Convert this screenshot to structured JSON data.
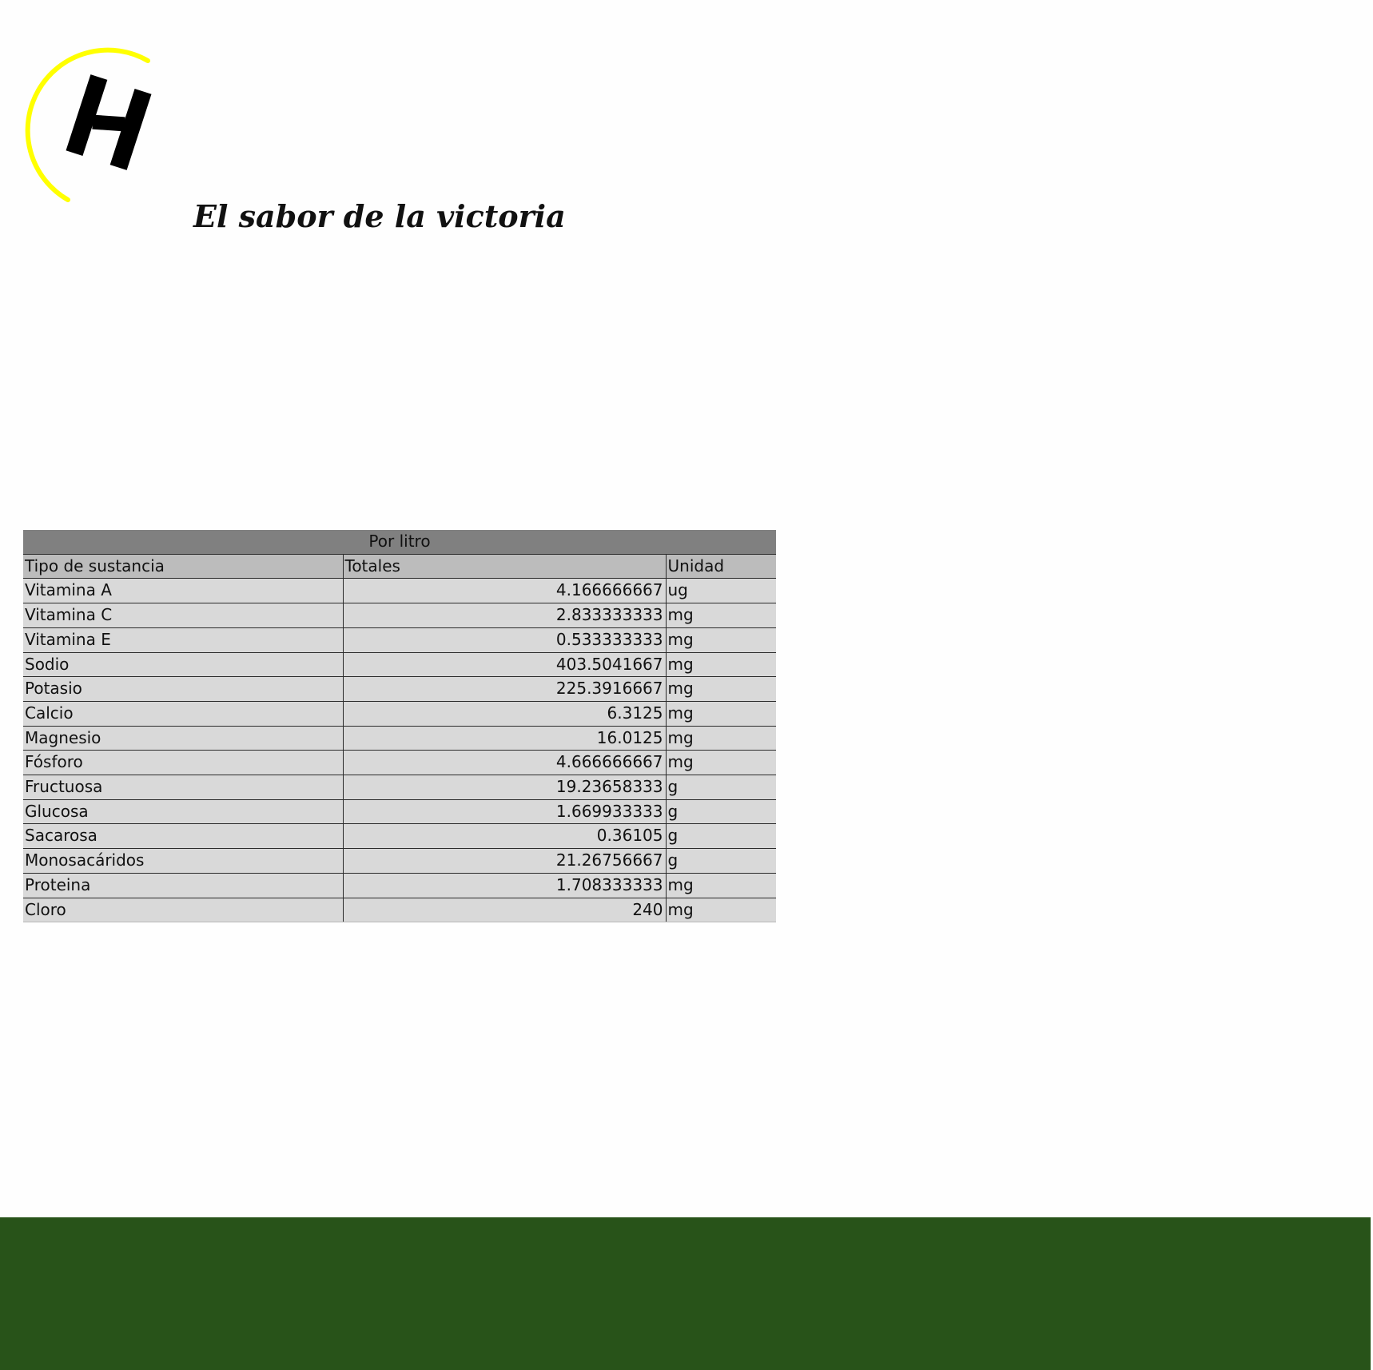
{
  "brand": {
    "tagline": "El sabor de la victoria",
    "logo_icon": "yellow-arc-h-logo",
    "colors": {
      "arc": "#ffff00",
      "mark": "#000000",
      "footer": "#285319"
    }
  },
  "table": {
    "title": "Por litro",
    "headers": {
      "name": "Tipo de sustancia",
      "total": "Totales",
      "unit": "Unidad"
    },
    "rows": [
      {
        "name": "Vitamina A",
        "total": "4.166666667",
        "unit": "ug"
      },
      {
        "name": "Vitamina C",
        "total": "2.833333333",
        "unit": "mg"
      },
      {
        "name": "Vitamina E",
        "total": "0.533333333",
        "unit": "mg"
      },
      {
        "name": "Sodio",
        "total": "403.5041667",
        "unit": "mg"
      },
      {
        "name": "Potasio",
        "total": "225.3916667",
        "unit": "mg"
      },
      {
        "name": "Calcio",
        "total": "6.3125",
        "unit": "mg"
      },
      {
        "name": "Magnesio",
        "total": "16.0125",
        "unit": "mg"
      },
      {
        "name": "Fósforo",
        "total": "4.666666667",
        "unit": "mg"
      },
      {
        "name": "Fructuosa",
        "total": "19.23658333",
        "unit": "g"
      },
      {
        "name": "Glucosa",
        "total": "1.669933333",
        "unit": "g"
      },
      {
        "name": "Sacarosa",
        "total": "0.36105",
        "unit": "g"
      },
      {
        "name": "Monosacáridos",
        "total": "21.26756667",
        "unit": "g"
      },
      {
        "name": "Proteina",
        "total": "1.708333333",
        "unit": "mg"
      },
      {
        "name": "Cloro",
        "total": "240",
        "unit": "mg"
      }
    ]
  }
}
